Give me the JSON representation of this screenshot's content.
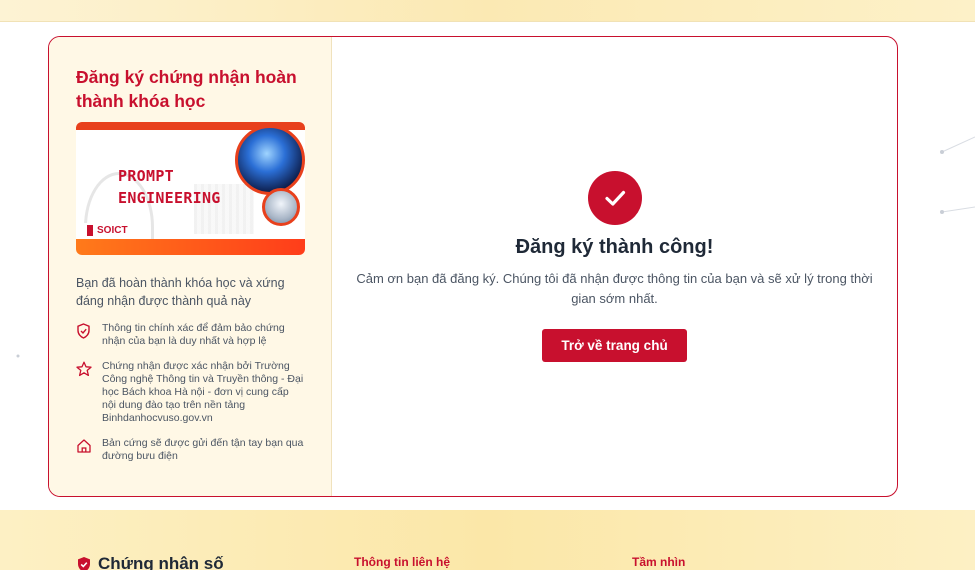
{
  "left_panel": {
    "title": "Đăng ký chứng nhận hoàn thành khóa học",
    "banner": {
      "line1": "PROMPT",
      "line2": "ENGINEERING",
      "brand": "SOICT"
    },
    "intro": "Bạn đã hoàn thành khóa học và xứng đáng nhận được thành quả này",
    "features": [
      {
        "icon": "shield-check-icon",
        "text": "Thông tin chính xác để đảm bảo chứng nhận của bạn là duy nhất và hợp lệ"
      },
      {
        "icon": "star-icon",
        "text": "Chứng nhận được xác nhận bởi Trường Công nghệ Thông tin và Truyền thông - Đại học Bách khoa Hà nội - đơn vị cung cấp nội dung đào tạo trên nền tảng Binhdanhocvuso.gov.vn"
      },
      {
        "icon": "home-icon",
        "text": "Bản cứng sẽ được gửi đến tận tay bạn qua đường bưu điện"
      }
    ]
  },
  "success": {
    "title": "Đăng ký thành công!",
    "message": "Cảm ơn bạn đã đăng ký. Chúng tôi đã nhận được thông tin của bạn và sẽ xử lý trong thời gian sớm nhất.",
    "button_label": "Trở về trang chủ"
  },
  "footer": {
    "brand": "Chứng nhận số",
    "col1": "Thông tin liên hệ",
    "col2": "Tầm nhìn"
  },
  "colors": {
    "primary": "#c8102e",
    "panel_bg": "#fff8e6",
    "footer_bg": "#fbe7a8"
  }
}
